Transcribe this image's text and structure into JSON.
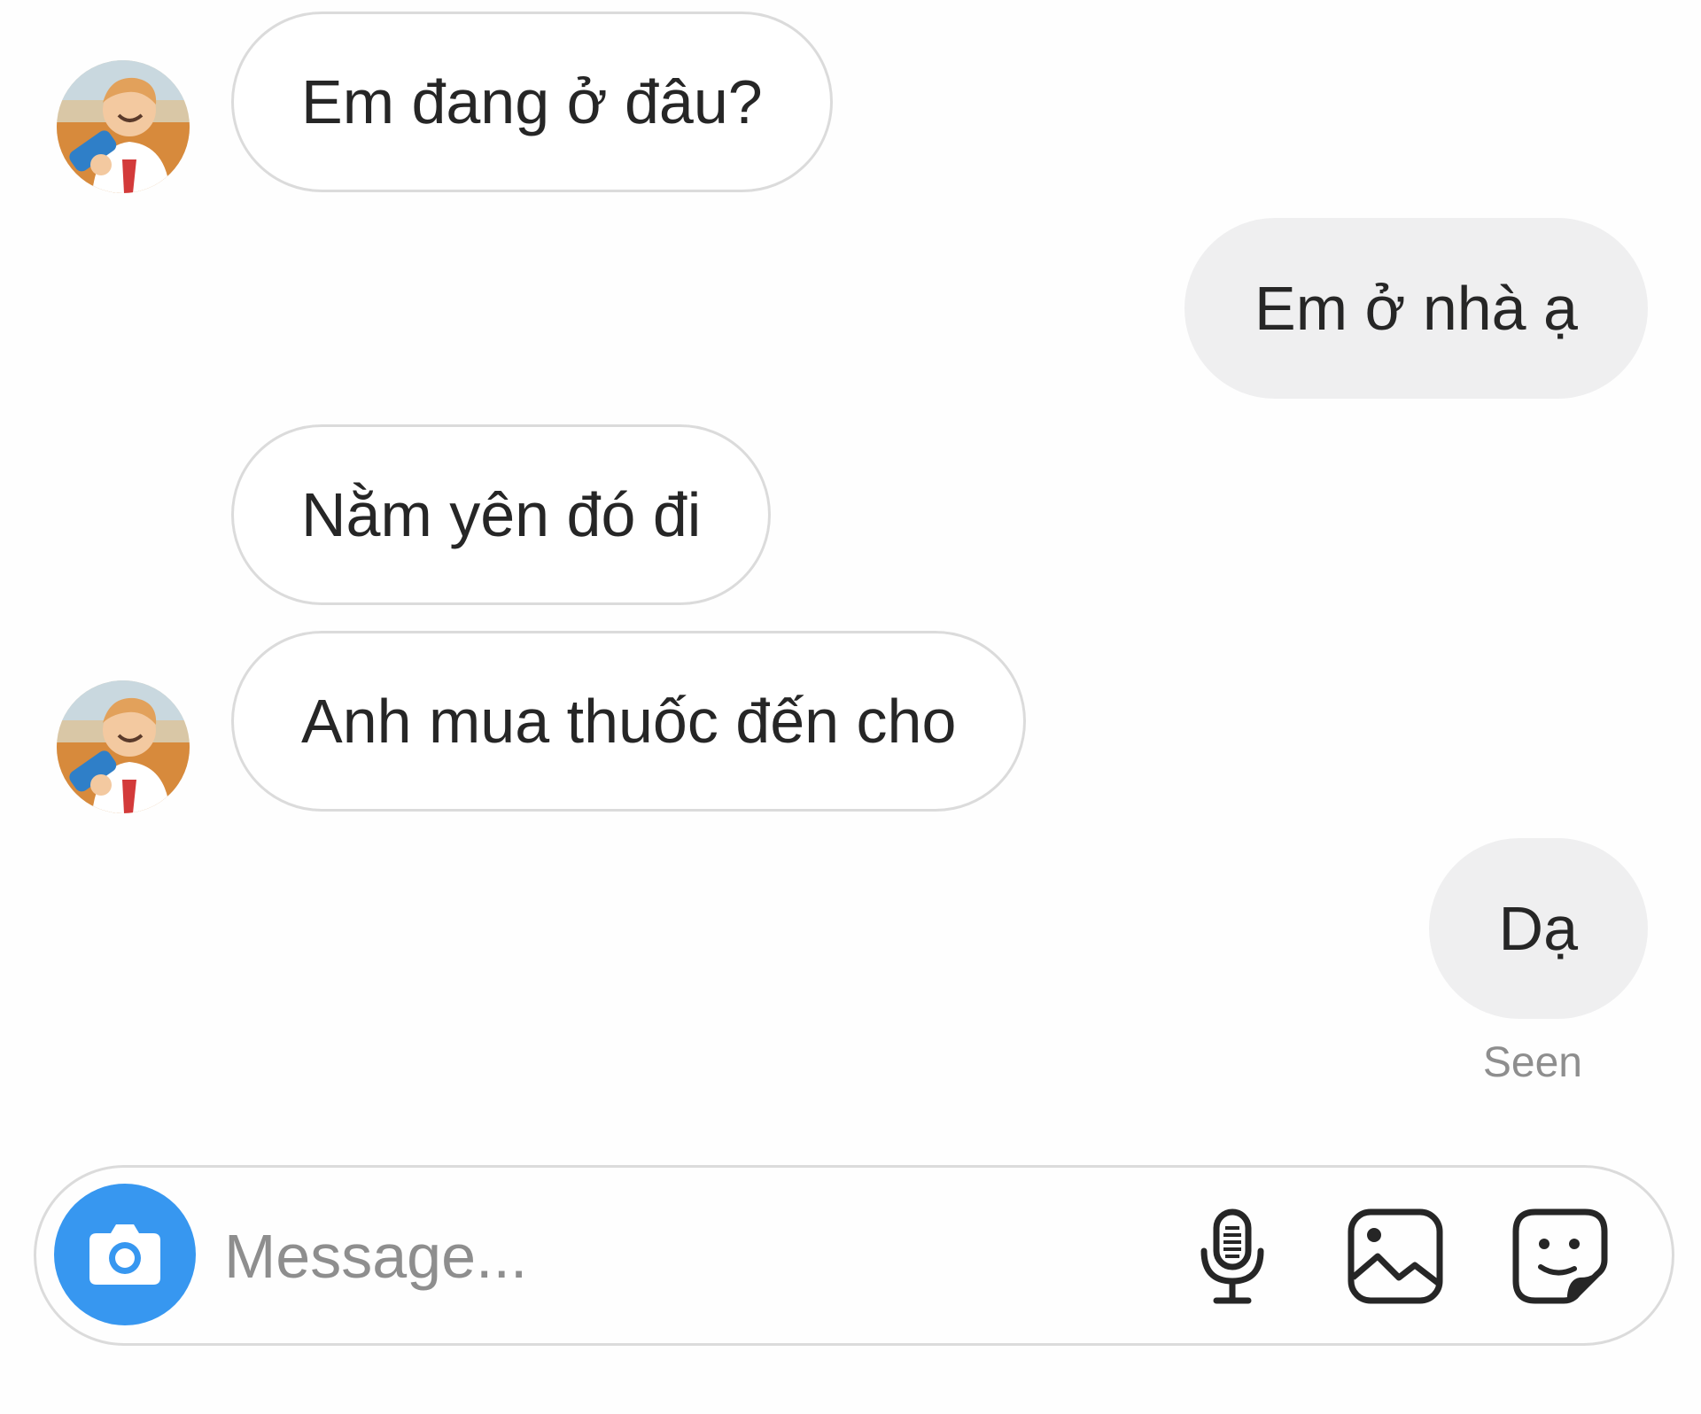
{
  "conversation": {
    "messages": [
      {
        "direction": "incoming",
        "text": "Em đang ở đâu?"
      },
      {
        "direction": "outgoing",
        "text": "Em ở nhà ạ"
      },
      {
        "direction": "incoming",
        "text": "Nằm yên đó đi"
      },
      {
        "direction": "incoming",
        "text": "Anh mua thuốc đến cho"
      },
      {
        "direction": "outgoing",
        "text": "Dạ"
      }
    ],
    "seen_label": "Seen"
  },
  "composer": {
    "placeholder": "Message...",
    "icons": [
      "camera-icon",
      "microphone-icon",
      "gallery-icon",
      "sticker-icon"
    ]
  },
  "colors": {
    "accent": "#3797f0",
    "incoming_border": "#dbdbdb",
    "outgoing_background": "#efeff0",
    "muted_text": "#8e8e8e"
  }
}
